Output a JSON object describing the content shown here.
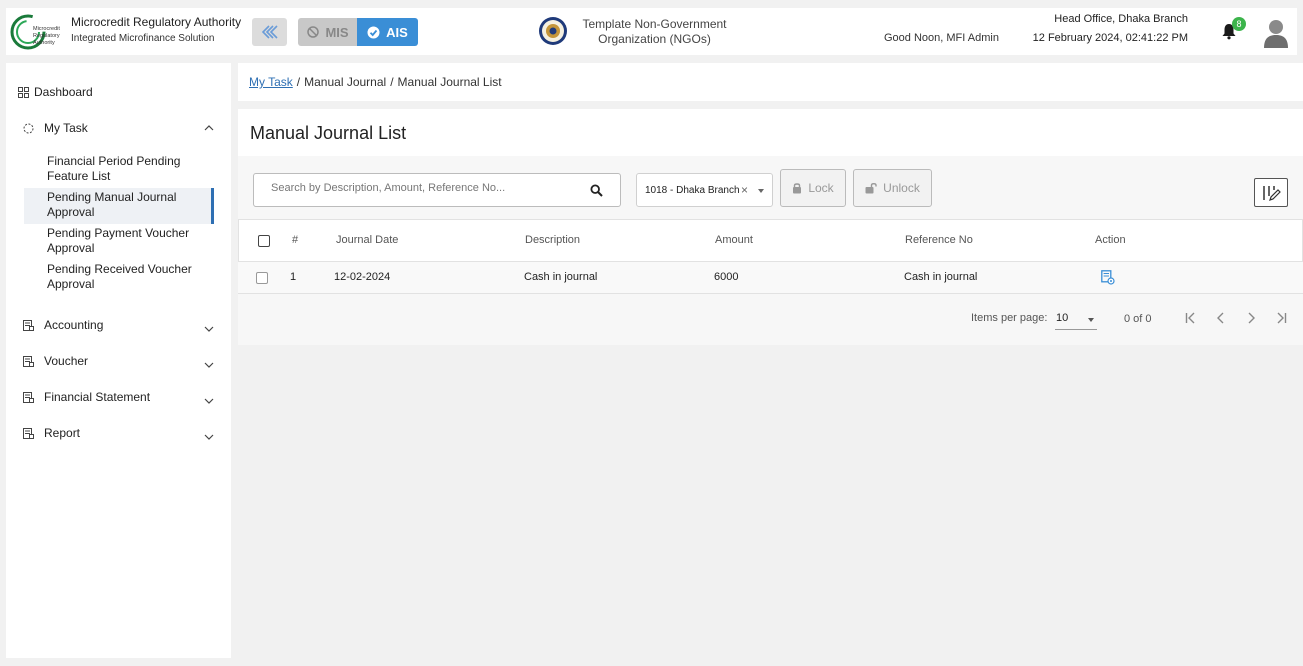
{
  "header": {
    "org_name": "Microcredit Regulatory Authority",
    "org_subtitle": "Integrated Microfinance Solution",
    "logo_text": [
      "Microcredit",
      "Regulatory",
      "Authority"
    ],
    "mis_label": "MIS",
    "ais_label": "AIS",
    "ngo_name": "Template Non-Government Organization (NGOs)",
    "greeting": "Good Noon, MFI Admin",
    "branch": "Head Office, Dhaka Branch",
    "datetime": "12 February 2024, 02:41:22 PM",
    "notification_count": "8"
  },
  "sidebar": {
    "dashboard": "Dashboard",
    "my_task": {
      "label": "My Task",
      "children": [
        "Financial Period Pending Feature List",
        "Pending Manual Journal Approval",
        "Pending Payment Voucher Approval",
        "Pending Received Voucher Approval"
      ],
      "active_index": 1
    },
    "accounting": "Accounting",
    "voucher": "Voucher",
    "financial_statement": "Financial Statement",
    "report": "Report"
  },
  "breadcrumb": {
    "link": "My Task",
    "middle": "Manual Journal",
    "current": "Manual Journal List"
  },
  "page": {
    "title": "Manual Journal List"
  },
  "toolbar": {
    "search_placeholder": "Search by Description, Amount, Reference No...",
    "branch_value": "1018 - Dhaka Branch",
    "lock_label": "Lock",
    "unlock_label": "Unlock"
  },
  "table": {
    "headers": {
      "num": "#",
      "journal_date": "Journal Date",
      "description": "Description",
      "amount": "Amount",
      "reference_no": "Reference No",
      "action": "Action"
    },
    "rows": [
      {
        "num": "1",
        "journal_date": "12-02-2024",
        "description": "Cash in journal",
        "amount": "6000",
        "reference_no": "Cash in journal"
      }
    ]
  },
  "paginator": {
    "items_per_page_label": "Items per page:",
    "items_per_page": "10",
    "range": "0 of 0"
  },
  "colors": {
    "accent": "#3a8ed6",
    "active_border": "#2e6fb3",
    "badge": "#3cb44b"
  },
  "icons": {
    "collapse": "double-chevron-left-icon",
    "mis": "ban-icon",
    "ais": "check-circle-icon",
    "notification": "bell-icon",
    "search": "search-icon",
    "lock": "lock-icon",
    "unlock": "unlock-icon",
    "edit_columns": "edit-columns-icon",
    "action": "view-document-icon"
  }
}
